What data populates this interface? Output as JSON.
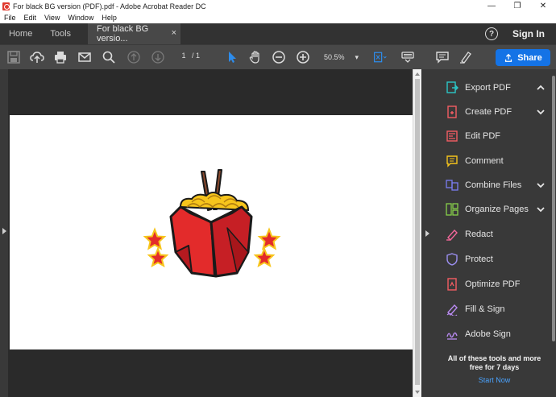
{
  "window": {
    "title": "For black BG version (PDF).pdf - Adobe Acrobat Reader DC",
    "minimize_glyph": "—",
    "maximize_glyph": "❐",
    "close_glyph": "✕"
  },
  "menu": [
    "File",
    "Edit",
    "View",
    "Window",
    "Help"
  ],
  "tabs": {
    "home": "Home",
    "tools": "Tools",
    "document": "For black BG versio...",
    "close_glyph": "×"
  },
  "header": {
    "help_glyph": "?",
    "sign_in": "Sign In"
  },
  "toolbar": {
    "page_current": "1",
    "page_total": "/ 1",
    "zoom": "50.5%",
    "zoom_caret": "▾",
    "share_label": "Share"
  },
  "tools_panel": {
    "items": [
      {
        "label": "Export PDF",
        "icon": "export-pdf-icon",
        "color": "#2bc6c6",
        "expander": "up"
      },
      {
        "label": "Create PDF",
        "icon": "create-pdf-icon",
        "color": "#f45c63",
        "expander": "down"
      },
      {
        "label": "Edit PDF",
        "icon": "edit-pdf-icon",
        "color": "#f45c63",
        "expander": ""
      },
      {
        "label": "Comment",
        "icon": "comment-icon",
        "color": "#f5c41c",
        "expander": ""
      },
      {
        "label": "Combine Files",
        "icon": "combine-files-icon",
        "color": "#7a7df2",
        "expander": "down"
      },
      {
        "label": "Organize Pages",
        "icon": "organize-pages-icon",
        "color": "#87d04a",
        "expander": "down"
      },
      {
        "label": "Redact",
        "icon": "redact-icon",
        "color": "#f2679a",
        "expander": ""
      },
      {
        "label": "Protect",
        "icon": "protect-icon",
        "color": "#9b8ff0",
        "expander": ""
      },
      {
        "label": "Optimize PDF",
        "icon": "optimize-pdf-icon",
        "color": "#f45c63",
        "expander": ""
      },
      {
        "label": "Fill & Sign",
        "icon": "fill-sign-icon",
        "color": "#b88af0",
        "expander": ""
      },
      {
        "label": "Adobe Sign",
        "icon": "adobe-sign-icon",
        "color": "#b88af0",
        "expander": ""
      }
    ],
    "promo_text": "All of these tools and more free for 7 days",
    "promo_link": "Start Now"
  },
  "colors": {
    "accent": "#1473e6",
    "dark_bg": "#2a2a2a",
    "panel_bg": "#393939",
    "toolbar_bg": "#484848",
    "logo_red": "#e32b2b",
    "logo_yellow": "#f7c51c",
    "logo_brown": "#8a4a2e"
  }
}
